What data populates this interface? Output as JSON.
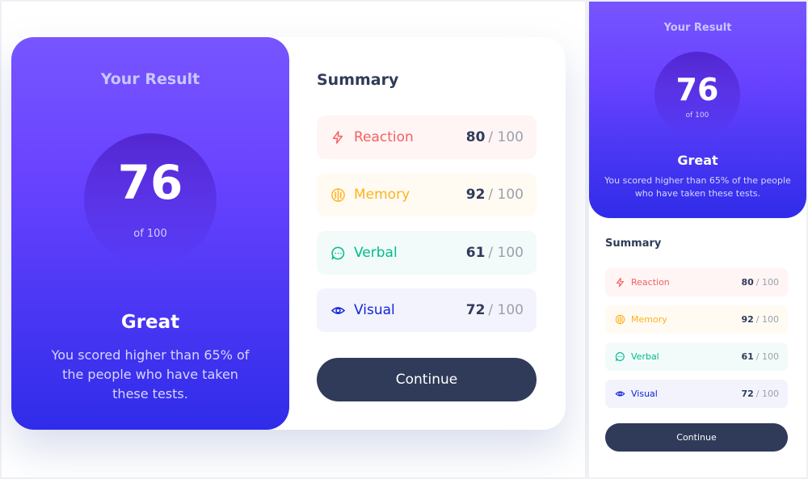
{
  "result": {
    "heading": "Your Result",
    "score": "76",
    "out_of": "of 100",
    "rating": "Great",
    "description": "You scored higher than 65% of the people who have taken these tests."
  },
  "summary": {
    "title": "Summary",
    "items": [
      {
        "label": "Reaction",
        "score": "80",
        "max": "/ 100",
        "icon": "lightning-icon",
        "color": "#f56060"
      },
      {
        "label": "Memory",
        "score": "92",
        "max": "/ 100",
        "icon": "brain-icon",
        "color": "#ffb21e"
      },
      {
        "label": "Verbal",
        "score": "61",
        "max": "/ 100",
        "icon": "speech-bubble-icon",
        "color": "#00bb8f"
      },
      {
        "label": "Visual",
        "score": "72",
        "max": "/ 100",
        "icon": "eye-icon",
        "color": "#1125d6"
      }
    ],
    "button_label": "Continue"
  },
  "colors": {
    "gradient_top": "#7755ff",
    "gradient_bottom": "#2f2ce9",
    "dark_navy": "#303b59"
  }
}
